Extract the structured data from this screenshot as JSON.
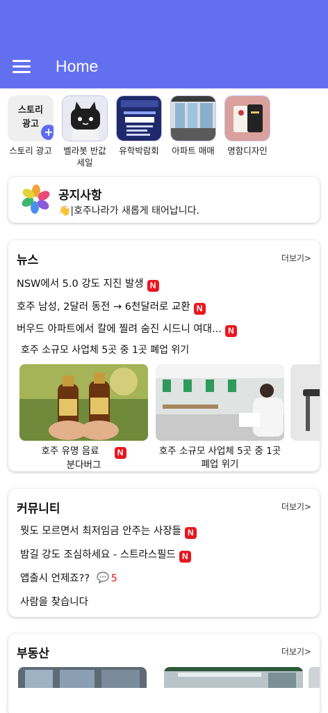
{
  "appbar": {
    "title": "Home",
    "color": "#6270f0"
  },
  "stories": [
    {
      "label": "스토리 광고",
      "thumb_text": "스토리\n광고",
      "is_add": true
    },
    {
      "label": "벨라봇 반값\n세일"
    },
    {
      "label": "유학박람회"
    },
    {
      "label": "아파트 매매"
    },
    {
      "label": "명함디자인"
    }
  ],
  "notice": {
    "title": "공지사항",
    "subtitle": "👋|호주나라가 새롭게 태어납니다."
  },
  "news": {
    "title": "뉴스",
    "more": "더보기>",
    "items": [
      {
        "text": "NSW에서 5.0 강도 지진 발생",
        "new": true
      },
      {
        "text": "호주 남성, 2달러 동전 → 6천달러로 교환",
        "new": true
      },
      {
        "text": "버우드 아파트에서 칼에 찔려 숨진 시드니 여대...",
        "new": true
      },
      {
        "text": "호주 소규모 사업체 5곳 중 1곳  폐업 위기",
        "new": false
      }
    ],
    "thumbs": [
      {
        "caption": "호주 유명 음료\n분다버그",
        "new": true
      },
      {
        "caption": "호주 소규모 사업체 5곳 중 1곳\n폐업 위기",
        "new": false
      }
    ]
  },
  "community": {
    "title": "커뮤니티",
    "more": "더보기>",
    "items": [
      {
        "text": "뭣도 모르면서 최저임금 안주는 사장들",
        "new": true
      },
      {
        "text": "밤길 강도 조심하세요 - 스트라스필드",
        "new": true
      },
      {
        "text": "앱출시 언제죠??",
        "comments": "5"
      },
      {
        "text": "사람을 찾습니다"
      }
    ]
  },
  "estate": {
    "title": "부동산",
    "more": "더보기>"
  },
  "new_badge": "N"
}
